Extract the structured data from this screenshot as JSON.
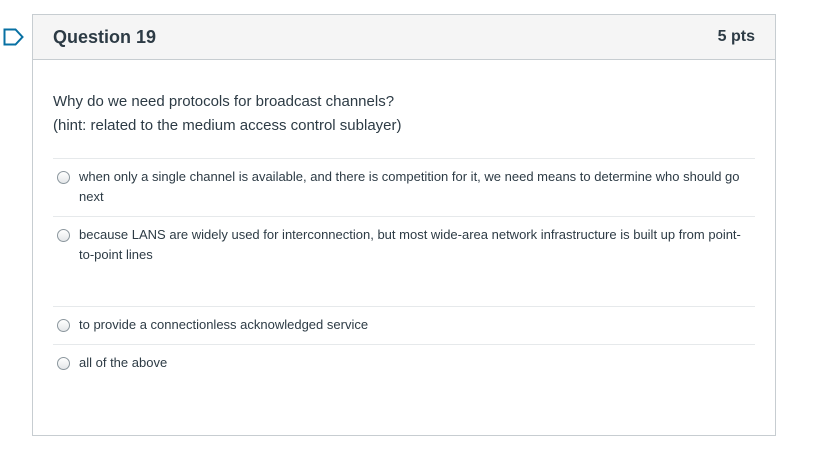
{
  "question": {
    "title": "Question 19",
    "points": "5 pts",
    "text_line1": "Why do we need protocols for broadcast channels?",
    "text_line2": "(hint: related to the medium access control sublayer)",
    "answers": [
      {
        "label": "when only a single channel is available, and there is competition for it, we need means to determine who should go next"
      },
      {
        "label": "because LANS are widely used for interconnection, but most wide-area network infrastructure is built up from point-to-point lines"
      },
      {
        "label": "to provide a connectionless acknowledged service"
      },
      {
        "label": "all of the above"
      }
    ]
  },
  "colors": {
    "accent": "#0770a3",
    "border": "#c7cdd1",
    "header_bg": "#f5f5f5",
    "text": "#2d3b45"
  },
  "icons": {
    "flag": "bookmark-flag-icon"
  }
}
